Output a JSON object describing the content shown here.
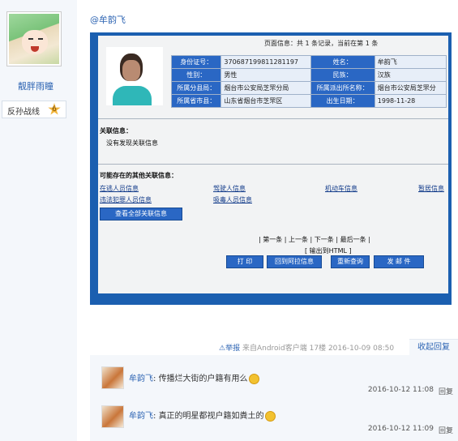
{
  "user": {
    "name": "靓胖雨瞳",
    "rank_label": "反孙战线",
    "rank_level": "6"
  },
  "post": {
    "mention": "@牟韵飞",
    "photo": {
      "page_info": "页面信息：共 1 条记录，当前在第 1 条",
      "fields": [
        {
          "label": "身份证号：",
          "value": "370687199811281197",
          "label2": "姓名：",
          "value2": "牟韵飞"
        },
        {
          "label": "性别：",
          "value": "男性",
          "label2": "民族：",
          "value2": "汉族"
        },
        {
          "label": "所属分县局：",
          "value": "烟台市公安局芝罘分局",
          "label2": "所属派出所名称：",
          "value2": "烟台市公安局芝罘分"
        },
        {
          "label": "所属省市县：",
          "value": "山东省烟台市芝罘区",
          "label2": "出生日期：",
          "value2": "1998-11-28"
        }
      ],
      "related_title": "关联信息：",
      "related_empty": "没有发现关联信息",
      "other_title": "可能存在的其他关联信息：",
      "links_row1": [
        "在逃人员信息",
        "驾驶人信息",
        "机动车信息",
        "暂居信息"
      ],
      "links_row2": [
        "违法犯罪人员信息",
        "吸毒人员信息"
      ],
      "view_all": "查看全部关联信息",
      "pager": "| 第一条 | 上一条 | 下一条 | 最后一条 |",
      "html_out": "[ 输出到HTML ]",
      "actions": [
        "打 印",
        "回到阿拉信息",
        "重新查询",
        "发 邮 件"
      ]
    },
    "footer": {
      "report": "⚠举报",
      "source": "来自Android客户端",
      "floor": "17楼",
      "time": "2016-10-09 08:50",
      "reply_toggle": "收起回复"
    }
  },
  "replies": [
    {
      "name": "牟韵飞",
      "text": "传播烂大街的户籍有用么",
      "time": "2016-10-12 11:08",
      "action": "回复"
    },
    {
      "name": "牟韵飞",
      "text": "真正的明星都视户籍如粪土的",
      "time": "2016-10-12 11:09",
      "action": "回复"
    }
  ]
}
